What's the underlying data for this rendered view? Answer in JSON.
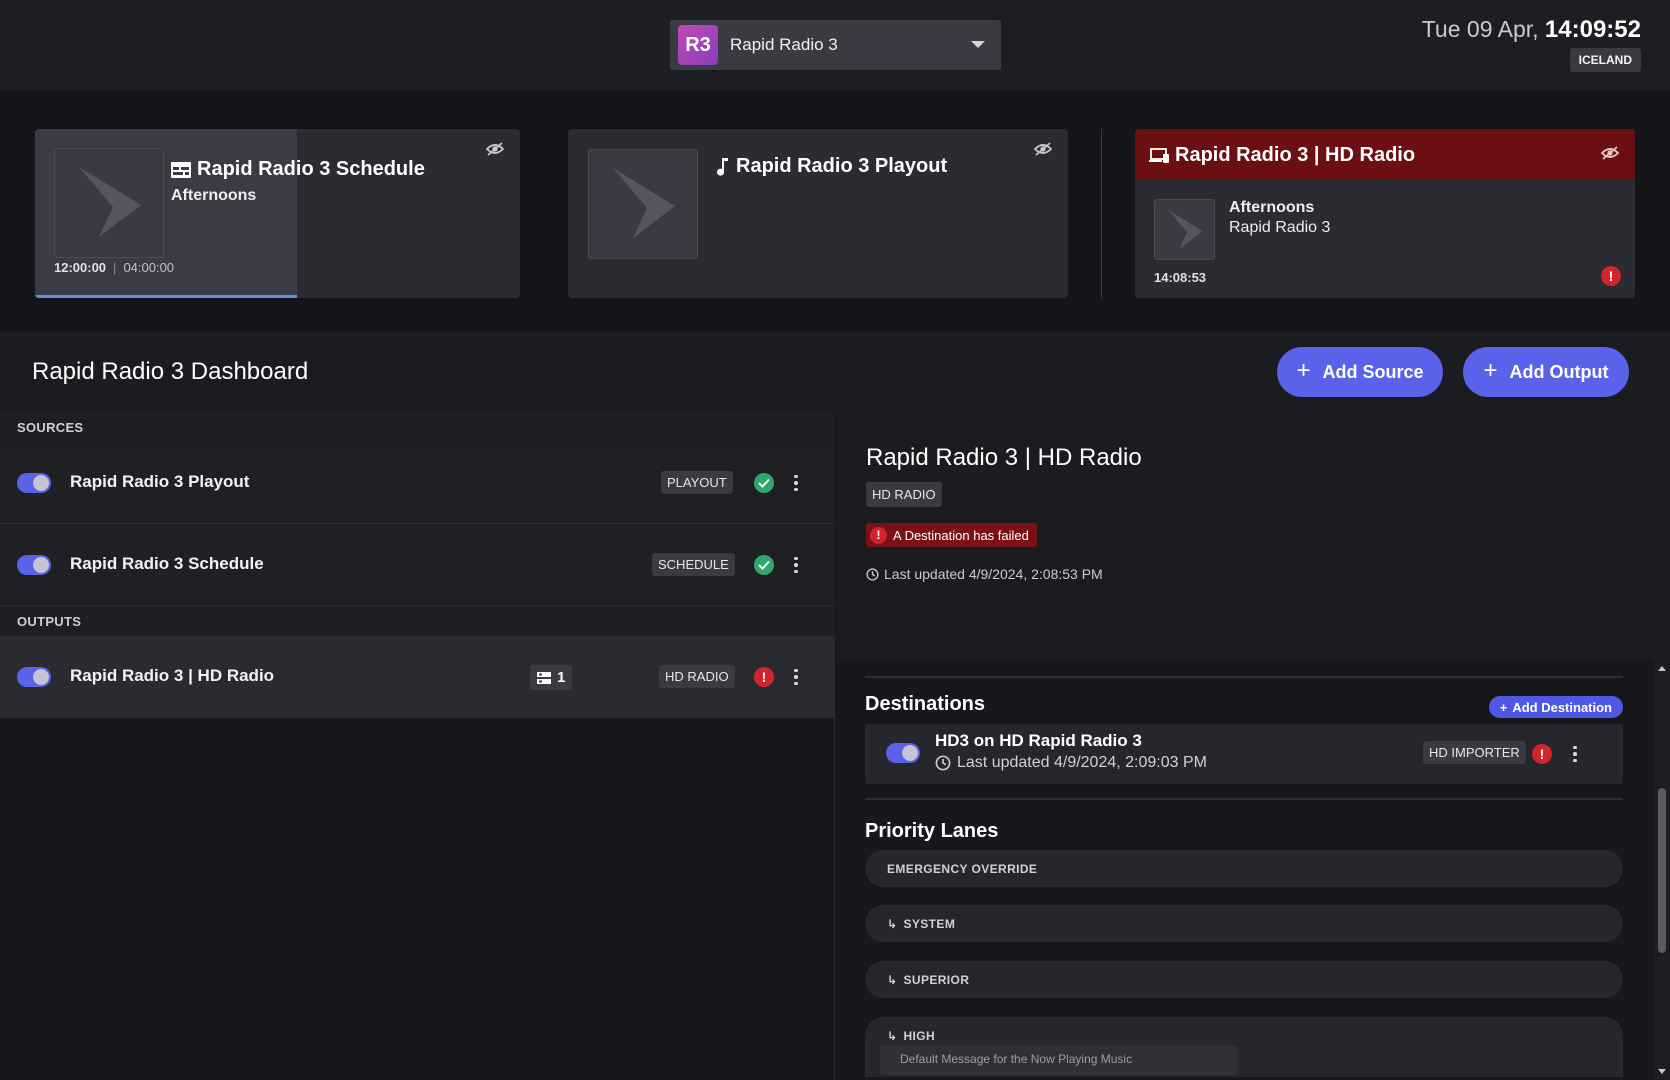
{
  "header": {
    "station_logo": "R3",
    "station_name": "Rapid Radio 3",
    "clock_date": "Tue 09 Apr,",
    "clock_time": "14:09:52",
    "region": "ICELAND"
  },
  "monitors": [
    {
      "title": "Rapid Radio 3 Schedule",
      "icon": "schedule-icon",
      "subtitle": "Afternoons",
      "elapsed": "12:00:00",
      "duration": "04:00:00",
      "progress_fraction": 0.54
    },
    {
      "title": "Rapid Radio 3 Playout",
      "icon": "music-note-icon"
    },
    {
      "title": "Rapid Radio 3 | HD Radio",
      "icon": "devices-icon",
      "now_title": "Afternoons",
      "now_artist": "Rapid Radio 3",
      "time": "14:08:53",
      "status": "error"
    }
  ],
  "dashboard": {
    "title": "Rapid Radio 3 Dashboard",
    "add_source": "Add Source",
    "add_output": "Add Output"
  },
  "sources_label": "SOURCES",
  "sources": [
    {
      "name": "Rapid Radio 3 Playout",
      "tag": "PLAYOUT",
      "status": "ok",
      "enabled": true
    },
    {
      "name": "Rapid Radio 3 Schedule",
      "tag": "SCHEDULE",
      "status": "ok",
      "enabled": true
    }
  ],
  "outputs_label": "OUTPUTS",
  "outputs": [
    {
      "name": "Rapid Radio 3 | HD Radio",
      "count": "1",
      "tag": "HD RADIO",
      "status": "error",
      "enabled": true
    }
  ],
  "detail": {
    "title": "Rapid Radio 3 | HD Radio",
    "tag": "HD RADIO",
    "alert": "A Destination has failed",
    "updated": "Last updated 4/9/2024, 2:08:53 PM",
    "destinations_title": "Destinations",
    "add_destination": "Add Destination",
    "destination": {
      "name": "HD3 on HD Rapid Radio 3",
      "updated": "Last updated 4/9/2024, 2:09:03 PM",
      "tag": "HD IMPORTER",
      "status": "error"
    },
    "priority_title": "Priority Lanes",
    "lanes": [
      "EMERGENCY OVERRIDE",
      "SYSTEM",
      "SUPERIOR",
      "HIGH"
    ],
    "lane_item": "Default Message for the Now Playing Music"
  },
  "colors": {
    "accent": "#5a62e9",
    "error": "#d4242b",
    "ok": "#2ea96b",
    "alert_header": "#6b0f12"
  }
}
